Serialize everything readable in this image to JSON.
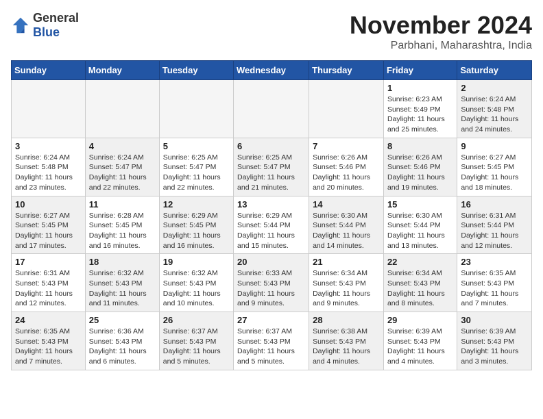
{
  "header": {
    "logo_general": "General",
    "logo_blue": "Blue",
    "month": "November 2024",
    "location": "Parbhani, Maharashtra, India"
  },
  "weekdays": [
    "Sunday",
    "Monday",
    "Tuesday",
    "Wednesday",
    "Thursday",
    "Friday",
    "Saturday"
  ],
  "weeks": [
    [
      {
        "day": "",
        "info": "",
        "empty": true
      },
      {
        "day": "",
        "info": "",
        "empty": true
      },
      {
        "day": "",
        "info": "",
        "empty": true
      },
      {
        "day": "",
        "info": "",
        "empty": true
      },
      {
        "day": "",
        "info": "",
        "empty": true
      },
      {
        "day": "1",
        "info": "Sunrise: 6:23 AM\nSunset: 5:49 PM\nDaylight: 11 hours and 25 minutes.",
        "empty": false,
        "shaded": false
      },
      {
        "day": "2",
        "info": "Sunrise: 6:24 AM\nSunset: 5:48 PM\nDaylight: 11 hours and 24 minutes.",
        "empty": false,
        "shaded": true
      }
    ],
    [
      {
        "day": "3",
        "info": "Sunrise: 6:24 AM\nSunset: 5:48 PM\nDaylight: 11 hours and 23 minutes.",
        "empty": false,
        "shaded": false
      },
      {
        "day": "4",
        "info": "Sunrise: 6:24 AM\nSunset: 5:47 PM\nDaylight: 11 hours and 22 minutes.",
        "empty": false,
        "shaded": true
      },
      {
        "day": "5",
        "info": "Sunrise: 6:25 AM\nSunset: 5:47 PM\nDaylight: 11 hours and 22 minutes.",
        "empty": false,
        "shaded": false
      },
      {
        "day": "6",
        "info": "Sunrise: 6:25 AM\nSunset: 5:47 PM\nDaylight: 11 hours and 21 minutes.",
        "empty": false,
        "shaded": true
      },
      {
        "day": "7",
        "info": "Sunrise: 6:26 AM\nSunset: 5:46 PM\nDaylight: 11 hours and 20 minutes.",
        "empty": false,
        "shaded": false
      },
      {
        "day": "8",
        "info": "Sunrise: 6:26 AM\nSunset: 5:46 PM\nDaylight: 11 hours and 19 minutes.",
        "empty": false,
        "shaded": true
      },
      {
        "day": "9",
        "info": "Sunrise: 6:27 AM\nSunset: 5:45 PM\nDaylight: 11 hours and 18 minutes.",
        "empty": false,
        "shaded": false
      }
    ],
    [
      {
        "day": "10",
        "info": "Sunrise: 6:27 AM\nSunset: 5:45 PM\nDaylight: 11 hours and 17 minutes.",
        "empty": false,
        "shaded": true
      },
      {
        "day": "11",
        "info": "Sunrise: 6:28 AM\nSunset: 5:45 PM\nDaylight: 11 hours and 16 minutes.",
        "empty": false,
        "shaded": false
      },
      {
        "day": "12",
        "info": "Sunrise: 6:29 AM\nSunset: 5:45 PM\nDaylight: 11 hours and 16 minutes.",
        "empty": false,
        "shaded": true
      },
      {
        "day": "13",
        "info": "Sunrise: 6:29 AM\nSunset: 5:44 PM\nDaylight: 11 hours and 15 minutes.",
        "empty": false,
        "shaded": false
      },
      {
        "day": "14",
        "info": "Sunrise: 6:30 AM\nSunset: 5:44 PM\nDaylight: 11 hours and 14 minutes.",
        "empty": false,
        "shaded": true
      },
      {
        "day": "15",
        "info": "Sunrise: 6:30 AM\nSunset: 5:44 PM\nDaylight: 11 hours and 13 minutes.",
        "empty": false,
        "shaded": false
      },
      {
        "day": "16",
        "info": "Sunrise: 6:31 AM\nSunset: 5:44 PM\nDaylight: 11 hours and 12 minutes.",
        "empty": false,
        "shaded": true
      }
    ],
    [
      {
        "day": "17",
        "info": "Sunrise: 6:31 AM\nSunset: 5:43 PM\nDaylight: 11 hours and 12 minutes.",
        "empty": false,
        "shaded": false
      },
      {
        "day": "18",
        "info": "Sunrise: 6:32 AM\nSunset: 5:43 PM\nDaylight: 11 hours and 11 minutes.",
        "empty": false,
        "shaded": true
      },
      {
        "day": "19",
        "info": "Sunrise: 6:32 AM\nSunset: 5:43 PM\nDaylight: 11 hours and 10 minutes.",
        "empty": false,
        "shaded": false
      },
      {
        "day": "20",
        "info": "Sunrise: 6:33 AM\nSunset: 5:43 PM\nDaylight: 11 hours and 9 minutes.",
        "empty": false,
        "shaded": true
      },
      {
        "day": "21",
        "info": "Sunrise: 6:34 AM\nSunset: 5:43 PM\nDaylight: 11 hours and 9 minutes.",
        "empty": false,
        "shaded": false
      },
      {
        "day": "22",
        "info": "Sunrise: 6:34 AM\nSunset: 5:43 PM\nDaylight: 11 hours and 8 minutes.",
        "empty": false,
        "shaded": true
      },
      {
        "day": "23",
        "info": "Sunrise: 6:35 AM\nSunset: 5:43 PM\nDaylight: 11 hours and 7 minutes.",
        "empty": false,
        "shaded": false
      }
    ],
    [
      {
        "day": "24",
        "info": "Sunrise: 6:35 AM\nSunset: 5:43 PM\nDaylight: 11 hours and 7 minutes.",
        "empty": false,
        "shaded": true
      },
      {
        "day": "25",
        "info": "Sunrise: 6:36 AM\nSunset: 5:43 PM\nDaylight: 11 hours and 6 minutes.",
        "empty": false,
        "shaded": false
      },
      {
        "day": "26",
        "info": "Sunrise: 6:37 AM\nSunset: 5:43 PM\nDaylight: 11 hours and 5 minutes.",
        "empty": false,
        "shaded": true
      },
      {
        "day": "27",
        "info": "Sunrise: 6:37 AM\nSunset: 5:43 PM\nDaylight: 11 hours and 5 minutes.",
        "empty": false,
        "shaded": false
      },
      {
        "day": "28",
        "info": "Sunrise: 6:38 AM\nSunset: 5:43 PM\nDaylight: 11 hours and 4 minutes.",
        "empty": false,
        "shaded": true
      },
      {
        "day": "29",
        "info": "Sunrise: 6:39 AM\nSunset: 5:43 PM\nDaylight: 11 hours and 4 minutes.",
        "empty": false,
        "shaded": false
      },
      {
        "day": "30",
        "info": "Sunrise: 6:39 AM\nSunset: 5:43 PM\nDaylight: 11 hours and 3 minutes.",
        "empty": false,
        "shaded": true
      }
    ]
  ]
}
